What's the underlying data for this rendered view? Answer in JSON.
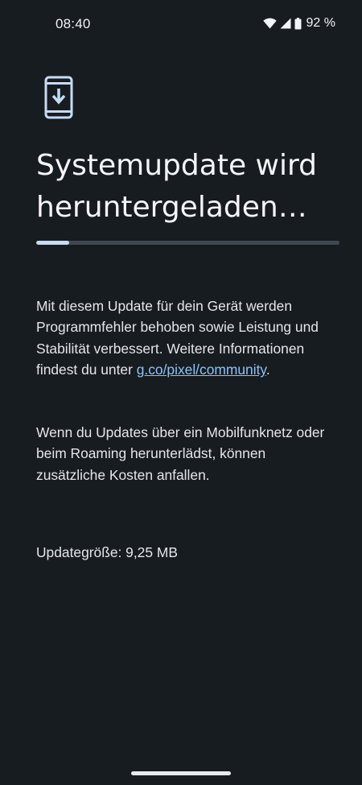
{
  "status_bar": {
    "time": "08:40",
    "battery": "92 %",
    "icons": [
      "wifi-icon",
      "signal-icon",
      "battery-icon"
    ]
  },
  "update": {
    "icon": "phone-download-icon",
    "title": "Systemupdate wird heruntergeladen…",
    "progress_fraction": 0.11,
    "description_before_link": "Mit diesem Update für dein Gerät werden Programmfehler behoben sowie Leistung und Stabilität verbessert. Weitere Informationen findest du unter ",
    "link_text": "g.co/pixel/community",
    "description_after_link": ".",
    "roaming_notice": "Wenn du Updates über ein Mobilfunknetz oder beim Roaming herunterlädst, können zusätzliche Kosten anfallen.",
    "size_label": "Updategröße: 9,25 MB"
  },
  "colors": {
    "background": "#171c21",
    "accent": "#c6dcf3",
    "link": "#8ec2f4"
  }
}
